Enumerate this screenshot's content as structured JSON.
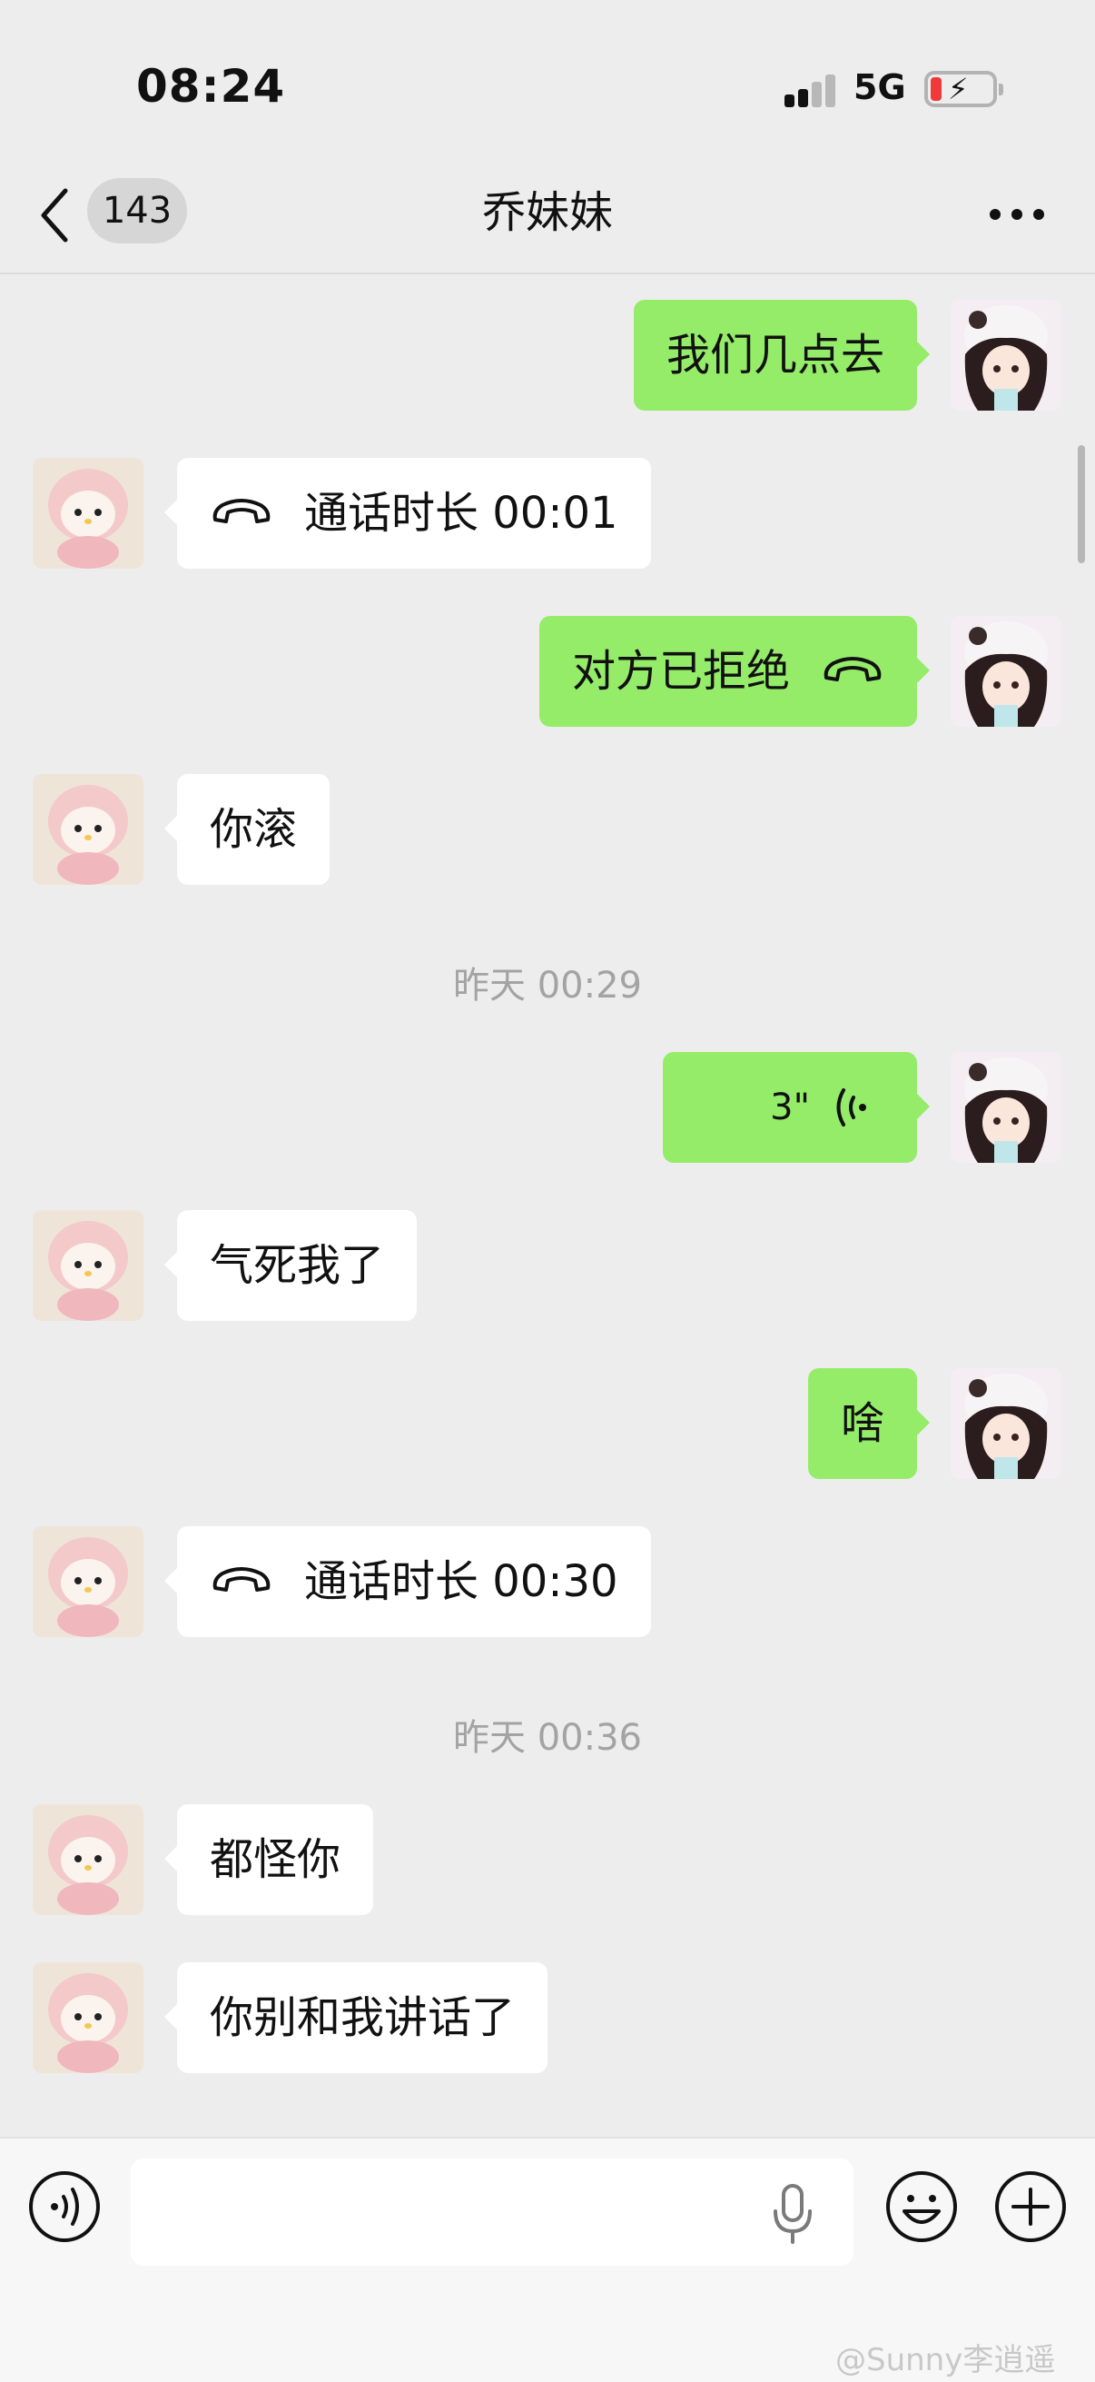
{
  "status_bar": {
    "time": "08:24",
    "network": "5G",
    "battery_color": "#f03a3a"
  },
  "nav": {
    "back_icon": "chevron-left-icon",
    "unread_count": "143",
    "title": "乔妹妹",
    "more_icon": "ellipsis-icon"
  },
  "colors": {
    "background": "#ededed",
    "my_bubble": "#95ec69",
    "their_bubble": "#ffffff"
  },
  "messages": [
    {
      "sender": "me",
      "type": "text",
      "text": "我们几点去"
    },
    {
      "sender": "them",
      "type": "call",
      "text": "通话时长 00:01",
      "icon": "phone-hangup-icon"
    },
    {
      "sender": "me",
      "type": "call",
      "text": "对方已拒绝",
      "icon": "phone-hangup-icon"
    },
    {
      "sender": "them",
      "type": "text",
      "text": "你滚"
    },
    {
      "type": "timestamp",
      "text": "昨天 00:29"
    },
    {
      "sender": "me",
      "type": "voice",
      "text": "3\"",
      "icon": "voice-wave-icon"
    },
    {
      "sender": "them",
      "type": "text",
      "text": "气死我了"
    },
    {
      "sender": "me",
      "type": "text",
      "text": "啥"
    },
    {
      "sender": "them",
      "type": "call",
      "text": "通话时长 00:30",
      "icon": "phone-hangup-icon"
    },
    {
      "type": "timestamp",
      "text": "昨天 00:36"
    },
    {
      "sender": "them",
      "type": "text",
      "text": "都怪你"
    },
    {
      "sender": "them",
      "type": "text",
      "text": "你别和我讲话了"
    }
  ],
  "input_bar": {
    "placeholder": "",
    "voice_icon": "voice-mode-icon",
    "mic_icon": "microphone-icon",
    "emoji_icon": "emoji-icon",
    "plus_icon": "plus-circle-icon"
  },
  "watermark": "@Sunny李逍遥"
}
